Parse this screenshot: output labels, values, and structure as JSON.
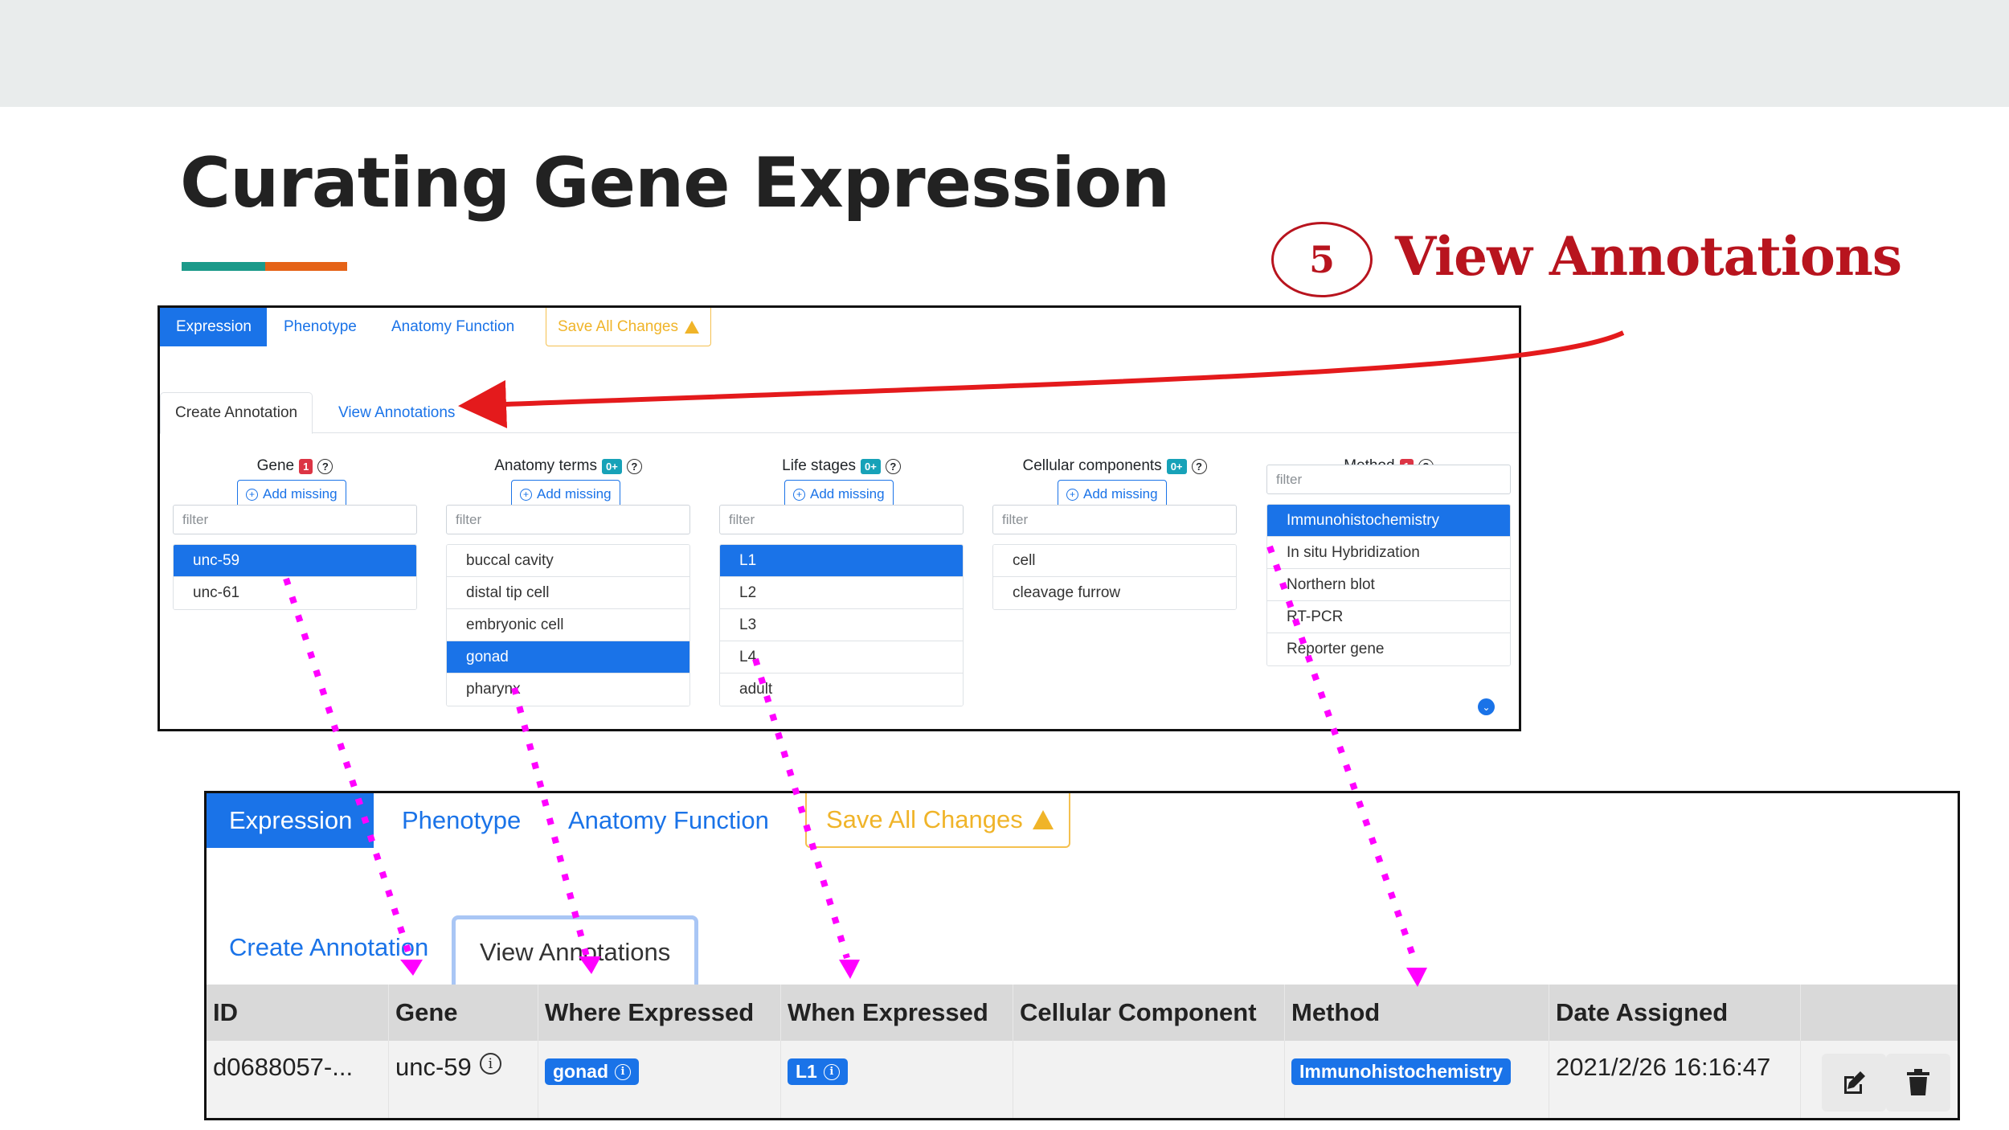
{
  "slide": {
    "title": "Curating Gene Expression",
    "step_number": "5",
    "step_label": "View Annotations",
    "colors": {
      "accent_red": "#b8141e",
      "rule_teal": "#1b9a8a",
      "rule_orange": "#e56317",
      "primary_blue": "#1a73e8",
      "warning_yellow": "#f0b429",
      "connector_magenta": "#ff00ff"
    }
  },
  "ui": {
    "nav_tabs": [
      "Expression",
      "Phenotype",
      "Anatomy Function"
    ],
    "save_label": "Save All Changes",
    "sub_tabs": [
      "Create Annotation",
      "View Annotations"
    ],
    "columns": {
      "gene": {
        "label": "Gene",
        "count": "1",
        "add": "Add missing",
        "filter": "filter",
        "items": [
          "unc-59",
          "unc-61"
        ],
        "selected": "unc-59"
      },
      "anatomy": {
        "label": "Anatomy terms",
        "count": "0+",
        "add": "Add missing",
        "filter": "filter",
        "items": [
          "buccal cavity",
          "distal tip cell",
          "embryonic cell",
          "gonad",
          "pharynx"
        ],
        "selected": "gonad"
      },
      "life": {
        "label": "Life stages",
        "count": "0+",
        "add": "Add missing",
        "filter": "filter",
        "items": [
          "L1",
          "L2",
          "L3",
          "L4",
          "adult"
        ],
        "selected": "L1"
      },
      "cellular": {
        "label": "Cellular components",
        "count": "0+",
        "add": "Add missing",
        "filter": "filter",
        "items": [
          "cell",
          "cleavage furrow"
        ]
      },
      "method": {
        "label": "Method",
        "count": "1",
        "filter": "filter",
        "items": [
          "Immunohistochemistry",
          "In situ Hybridization",
          "Northern blot",
          "RT-PCR",
          "Reporter gene"
        ],
        "selected": "Immunohistochemistry"
      }
    }
  },
  "view": {
    "nav_tabs": [
      "Expression",
      "Phenotype",
      "Anatomy Function"
    ],
    "save_label": "Save All Changes",
    "sub_tabs": [
      "Create Annotation",
      "View Annotations"
    ],
    "table": {
      "headers": [
        "ID",
        "Gene",
        "Where Expressed",
        "When Expressed",
        "Cellular Component",
        "Method",
        "Date Assigned"
      ],
      "row": {
        "id": "d0688057-...",
        "gene": "unc-59",
        "where": "gonad",
        "when": "L1",
        "cellular": "",
        "method": "Immunohistochemistry",
        "date": "2021/2/26 16:16:47"
      }
    }
  }
}
